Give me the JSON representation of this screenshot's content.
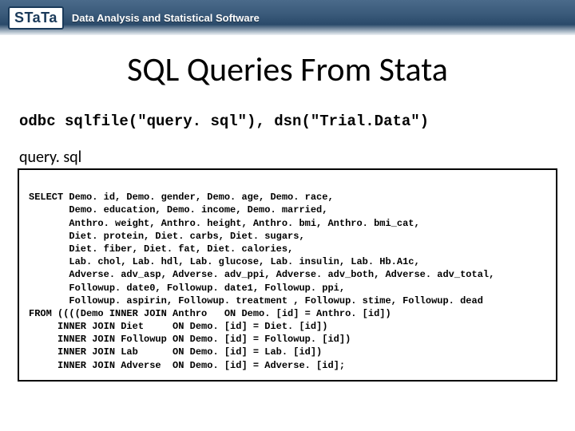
{
  "header": {
    "logo_text": "STaTa",
    "tagline": "Data Analysis and Statistical Software"
  },
  "slide": {
    "title": "SQL Queries From Stata",
    "command": "odbc sqlfile(\"query. sql\"), dsn(\"Trial.Data\")",
    "file_label": "query. sql"
  },
  "sql_lines": [
    "SELECT Demo. id, Demo. gender, Demo. age, Demo. race,",
    "       Demo. education, Demo. income, Demo. married,",
    "       Anthro. weight, Anthro. height, Anthro. bmi, Anthro. bmi_cat,",
    "       Diet. protein, Diet. carbs, Diet. sugars,",
    "       Diet. fiber, Diet. fat, Diet. calories,",
    "       Lab. chol, Lab. hdl, Lab. glucose, Lab. insulin, Lab. Hb.A1c,",
    "       Adverse. adv_asp, Adverse. adv_ppi, Adverse. adv_both, Adverse. adv_total,",
    "       Followup. date0, Followup. date1, Followup. ppi,",
    "       Followup. aspirin, Followup. treatment , Followup. stime, Followup. dead",
    "FROM ((((Demo INNER JOIN Anthro   ON Demo. [id] = Anthro. [id])",
    "     INNER JOIN Diet     ON Demo. [id] = Diet. [id])",
    "     INNER JOIN Followup ON Demo. [id] = Followup. [id])",
    "     INNER JOIN Lab      ON Demo. [id] = Lab. [id])",
    "     INNER JOIN Adverse  ON Demo. [id] = Adverse. [id];"
  ]
}
